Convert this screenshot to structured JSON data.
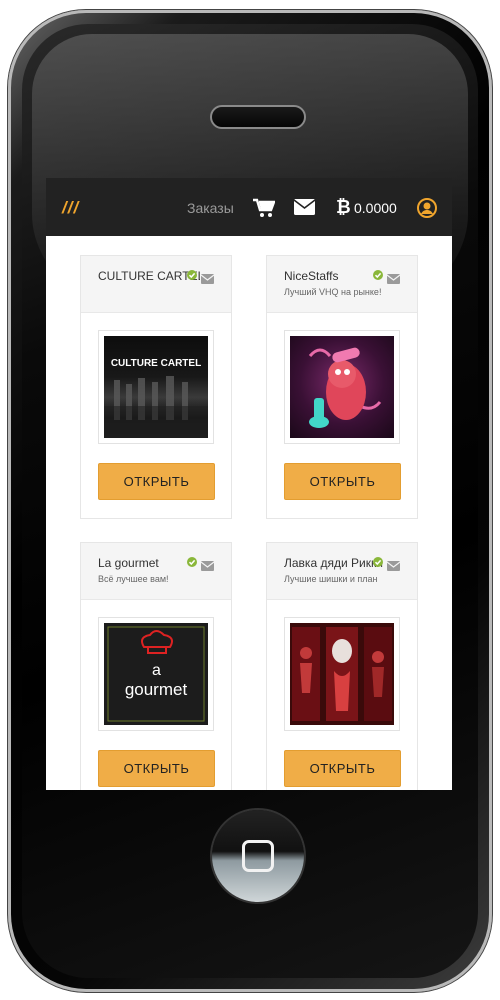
{
  "header": {
    "brand": "///",
    "orders_label": "Заказы",
    "balance": "0.0000",
    "icons": [
      "cart-icon",
      "mail-icon",
      "bitcoin-icon",
      "user-icon"
    ]
  },
  "colors": {
    "accent": "#f0ad47",
    "topbar": "#222222",
    "verified": "#8ab73a"
  },
  "shops": [
    {
      "name": "CULTURE CARTEL",
      "description": "",
      "button": "ОТКРЫТЬ",
      "logo_text": "CULTURE CARTEL",
      "verified": true
    },
    {
      "name": "NiceStaffs",
      "description": "Лучший VHQ на рынке!",
      "button": "ОТКРЫТЬ",
      "logo_text": "",
      "verified": true
    },
    {
      "name": "La gourmet",
      "description": "Всё лучшее вам!",
      "button": "ОТКРЫТЬ",
      "logo_text": "gourmet",
      "logo_text_small": "a",
      "verified": true
    },
    {
      "name": "Лавка дяди Рикки",
      "description": "Лучшие шишки и план",
      "button": "ОТКРЫТЬ",
      "logo_text": "",
      "verified": true
    }
  ]
}
